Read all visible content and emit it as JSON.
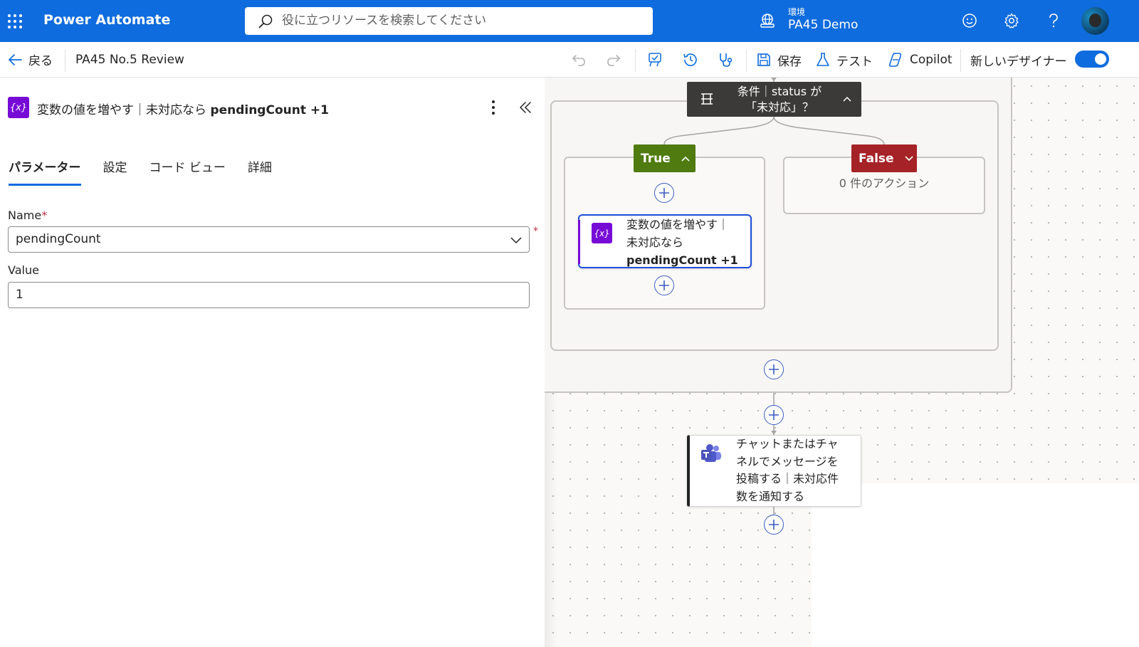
{
  "header": {
    "app_name": "Power Automate",
    "search_placeholder": "役に立つリソースを検索してください",
    "environment_label": "環境",
    "environment_name": "PA45 Demo"
  },
  "command_bar": {
    "back_label": "戻る",
    "flow_name": "PA45 No.5 Review",
    "save_label": "保存",
    "test_label": "テスト",
    "copilot_label": "Copilot",
    "new_designer_label": "新しいデザイナー",
    "new_designer_on": true
  },
  "panel": {
    "title_prefix": "変数の値を増やす｜未対応なら ",
    "title_bold": "pendingCount +1",
    "tabs": [
      "パラメーター",
      "設定",
      "コード ビュー",
      "詳細"
    ],
    "active_tab": "パラメーター",
    "name_label": "Name",
    "required_mark": "*",
    "name_value": "pendingCount",
    "value_label": "Value",
    "value_value": "1"
  },
  "canvas": {
    "condition_title_line1": "条件｜status が",
    "condition_title_line2": "「未対応」？",
    "true_label": "True",
    "false_label": "False",
    "false_actions": "0 件のアクション",
    "increment_card_line1": "変数の値を増やす｜",
    "increment_card_line2": "未対応なら",
    "increment_card_line3": "pendingCount +1",
    "teams_card_line1": "チャットまたはチャ",
    "teams_card_line2": "ネルでメッセージを",
    "teams_card_line3": "投稿する｜未対応件",
    "teams_card_line4": "数を通知する"
  },
  "colors": {
    "header_blue": "#0f6cde",
    "variable_purple": "#770bd6",
    "true_green": "#4f7b10",
    "false_red": "#a52226",
    "condition_dark": "#3b3a39"
  }
}
